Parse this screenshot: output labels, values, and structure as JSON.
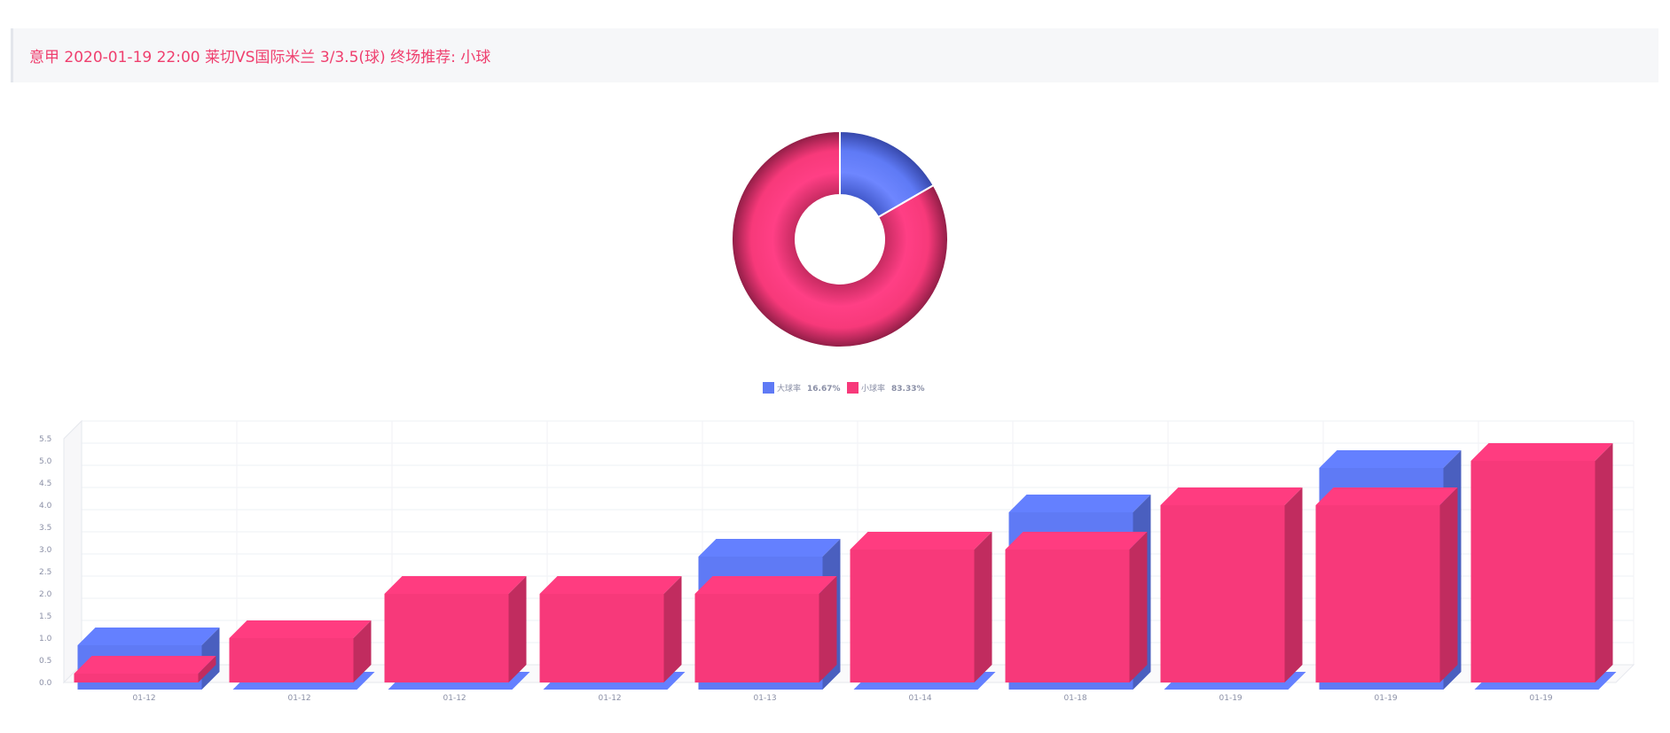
{
  "header": {
    "title": "意甲 2020-01-19 22:00 莱切VS国际米兰 3/3.5(球) 终场推荐: 小球"
  },
  "colors": {
    "blue": "#5f7af5",
    "pink": "#f7397a"
  },
  "chart_data": [
    {
      "type": "pie",
      "variant": "donut",
      "legend_position": "bottom",
      "slices": [
        {
          "label": "大球率",
          "percent_label": "16.67%",
          "value": 16.67,
          "color": "#5f7af5"
        },
        {
          "label": "小球率",
          "percent_label": "83.33%",
          "value": 83.33,
          "color": "#f7397a"
        }
      ]
    },
    {
      "type": "bar",
      "style": "3d",
      "grid": true,
      "categories": [
        "01-12",
        "01-12",
        "01-12",
        "01-12",
        "01-13",
        "01-14",
        "01-18",
        "01-19",
        "01-19",
        "01-19"
      ],
      "ylim": [
        0,
        5.5
      ],
      "yticks": [
        "0.0",
        "0.5",
        "1.0",
        "1.5",
        "2.0",
        "2.5",
        "3.0",
        "3.5",
        "4.0",
        "4.5",
        "5.0",
        "5.5"
      ],
      "series": [
        {
          "values": [
            1,
            0,
            0,
            0,
            3,
            0,
            4,
            0,
            5,
            0
          ],
          "color": "#5f7af5"
        },
        {
          "values": [
            0,
            1,
            2,
            2,
            2,
            3,
            3,
            4,
            4,
            5
          ],
          "color": "#f7397a"
        }
      ]
    }
  ]
}
